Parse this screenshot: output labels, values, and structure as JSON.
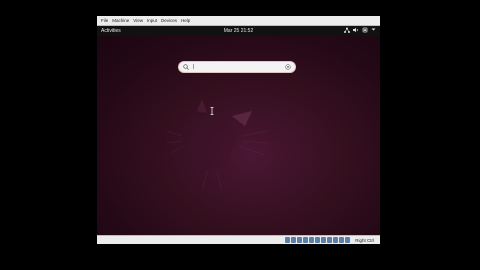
{
  "vbox_menu": [
    "File",
    "Machine",
    "View",
    "Input",
    "Devices",
    "Help"
  ],
  "gnome": {
    "activities": "Activities",
    "clock": "Mar 25  21:52"
  },
  "search": {
    "value": "",
    "caret": "|"
  },
  "statusbar": {
    "host_key": "Right Ctrl"
  },
  "icons": [
    "network-icon",
    "volume-icon",
    "power-icon",
    "chevron-down-icon",
    "search-icon",
    "clear-icon"
  ],
  "colors": {
    "desktop": "#2b0b1f",
    "search_bg": "#f3f3f3",
    "topbar": "#111111"
  }
}
